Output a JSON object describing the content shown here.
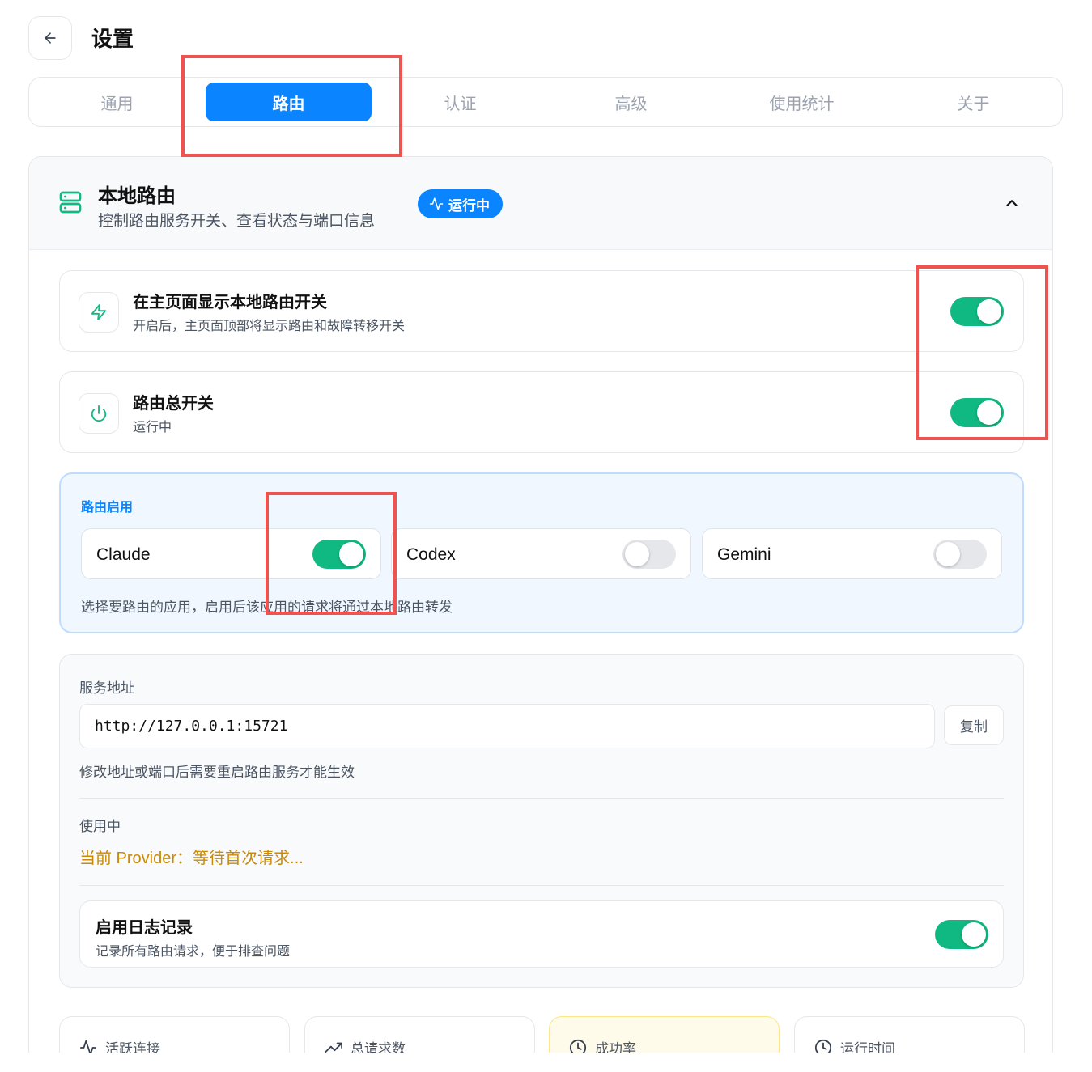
{
  "header": {
    "title": "设置"
  },
  "tabs": [
    {
      "label": "通用"
    },
    {
      "label": "路由",
      "active": true
    },
    {
      "label": "认证"
    },
    {
      "label": "高级"
    },
    {
      "label": "使用统计"
    },
    {
      "label": "关于"
    }
  ],
  "section": {
    "title": "本地路由",
    "subtitle": "控制路由服务开关、查看状态与端口信息",
    "status": "运行中"
  },
  "settings": [
    {
      "title": "在主页面显示本地路由开关",
      "desc": "开启后，主页面顶部将显示路由和故障转移开关",
      "icon": "lightning-icon",
      "enabled": true
    },
    {
      "title": "路由总开关",
      "desc": "运行中",
      "icon": "power-icon",
      "enabled": true
    }
  ],
  "routing": {
    "label": "路由启用",
    "apps": [
      {
        "name": "Claude",
        "enabled": true
      },
      {
        "name": "Codex",
        "enabled": false
      },
      {
        "name": "Gemini",
        "enabled": false
      }
    ],
    "hint": "选择要路由的应用，启用后该应用的请求将通过本地路由转发"
  },
  "service": {
    "address_label": "服务地址",
    "address": "http://127.0.0.1:15721",
    "copy_label": "复制",
    "address_hint": "修改地址或端口后需要重启路由服务才能生效",
    "in_use_label": "使用中",
    "provider_text": "当前 Provider：等待首次请求...",
    "logging": {
      "title": "启用日志记录",
      "desc": "记录所有路由请求，便于排查问题",
      "enabled": true
    }
  },
  "stats": [
    {
      "label": "活跃连接",
      "icon": "activity-icon"
    },
    {
      "label": "总请求数",
      "icon": "trending-up-icon"
    },
    {
      "label": "成功率",
      "icon": "clock-icon"
    },
    {
      "label": "运行时间",
      "icon": "clock-icon"
    }
  ],
  "colors": {
    "accent": "#0a84ff",
    "toggle_on": "#10b981",
    "highlight": "#ef5350",
    "provider": "#c88a0a"
  }
}
